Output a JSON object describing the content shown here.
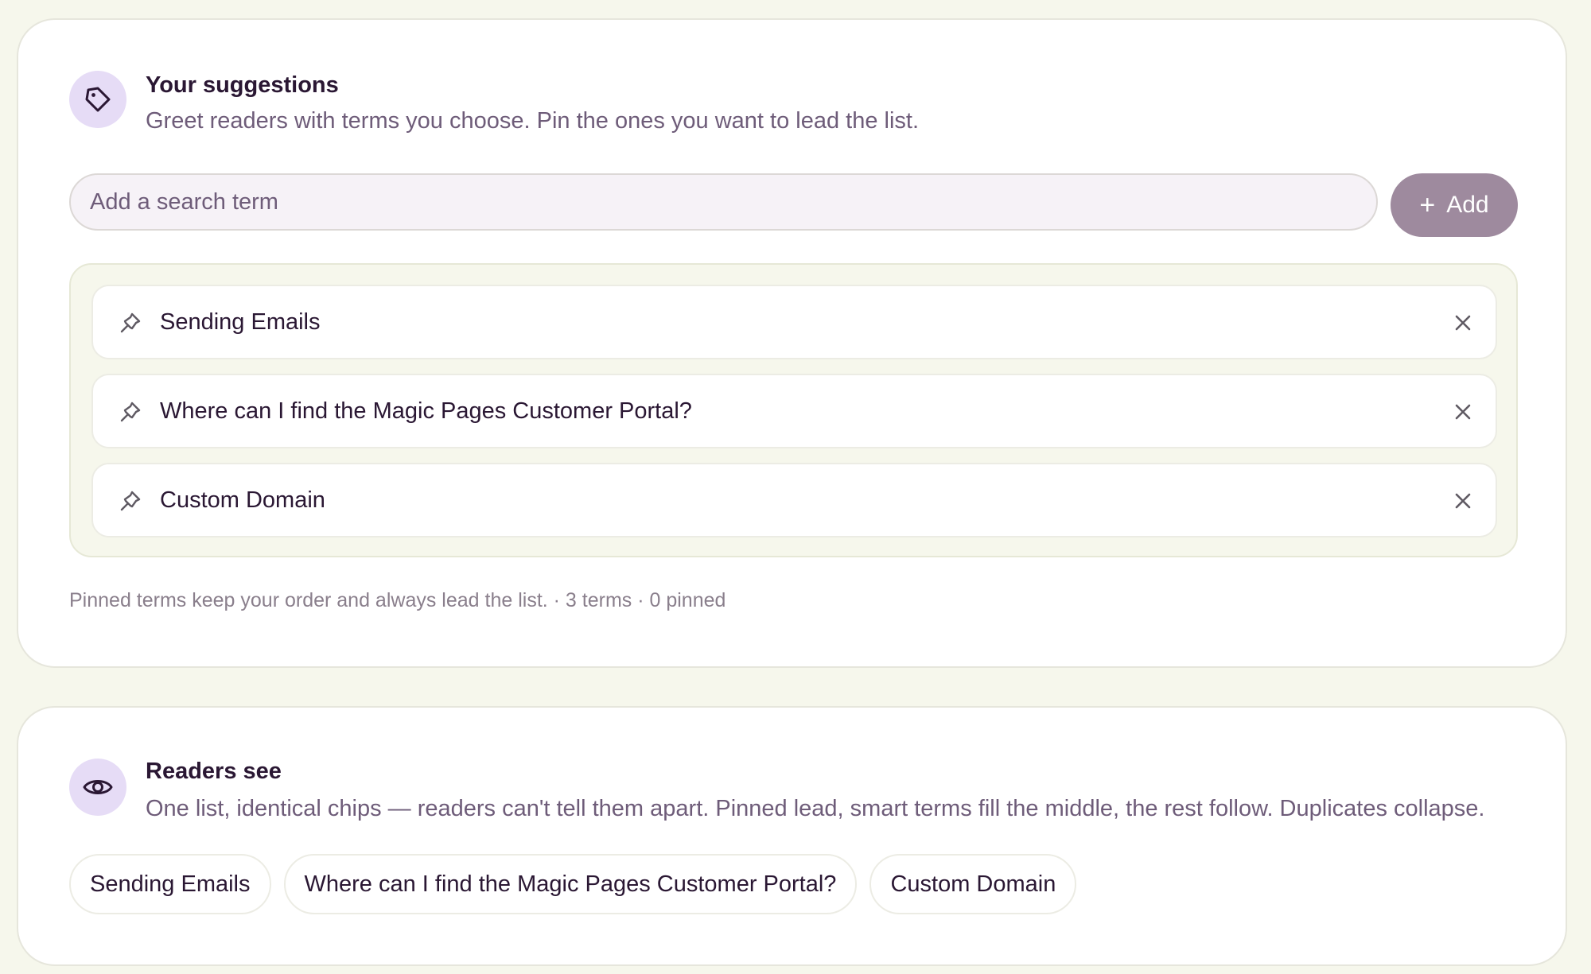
{
  "suggestions": {
    "icon": "tag-icon",
    "title": "Your suggestions",
    "subtitle": "Greet readers with terms you choose. Pin the ones you want to lead the list.",
    "search": {
      "placeholder": "Add a search term",
      "value": ""
    },
    "add_button": {
      "icon": "plus-icon",
      "label": "Add"
    },
    "terms": [
      {
        "label": "Sending Emails",
        "pinned": false,
        "pin_icon": "pin-icon",
        "remove_icon": "close-icon"
      },
      {
        "label": "Where can I find the Magic Pages Customer Portal?",
        "pinned": false,
        "pin_icon": "pin-icon",
        "remove_icon": "close-icon"
      },
      {
        "label": "Custom Domain",
        "pinned": false,
        "pin_icon": "pin-icon",
        "remove_icon": "close-icon"
      }
    ],
    "footnote": "Pinned terms keep your order and always lead the list. · 3 terms · 0 pinned"
  },
  "readers": {
    "icon": "eye-icon",
    "title": "Readers see",
    "subtitle": "One list, identical chips — readers can't tell them apart. Pinned lead, smart terms fill the middle, the rest follow. Duplicates collapse.",
    "chips": [
      "Sending Emails",
      "Where can I find the Magic Pages Customer Portal?",
      "Custom Domain"
    ]
  },
  "colors": {
    "page_background": "#f6f7ec",
    "card_background": "#ffffff",
    "icon_circle": "#e6dcf6",
    "primary_text": "#2a1733",
    "muted_text": "#6e5c79",
    "add_button": "#9e8a9e"
  }
}
